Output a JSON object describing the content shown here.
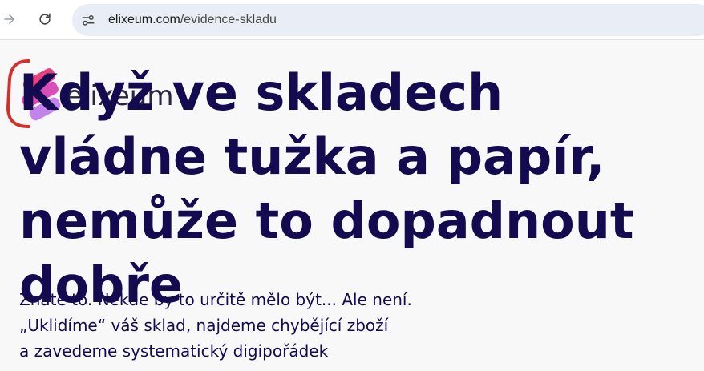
{
  "browser": {
    "url_domain": "elixeum.com",
    "url_path": "/evidence-skladu",
    "forward_icon": "arrow-forward-icon",
    "reload_icon": "reload-icon",
    "site_info_icon": "tune-icon"
  },
  "logo": {
    "text": "elixeum",
    "colors": [
      "#e8407a",
      "#c54fd6",
      "#d0312d"
    ]
  },
  "hero": {
    "title": "Když ve skladech vládne tužka a papír, nemůže to dopadnout dobře",
    "lines": [
      "Znáte to. Někde by to určitě mělo být... Ale není.",
      "„Uklidíme“ váš sklad, najdeme chybějící zboží",
      "a zavedeme systematický digipořádek"
    ]
  },
  "colors": {
    "heading": "#140a4f",
    "page_background": "#f8f8f9",
    "omnibox": "#e9eef6"
  }
}
